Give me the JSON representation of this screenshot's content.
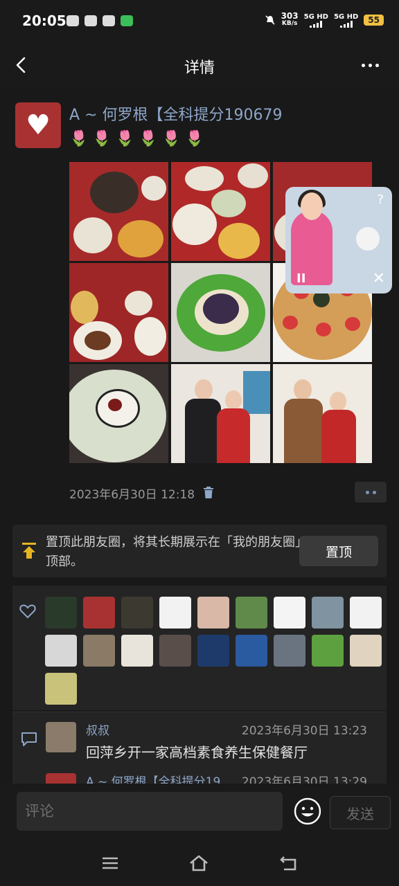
{
  "status_bar": {
    "time": "20:05",
    "speed": "303",
    "speed_unit": "KB/s",
    "net1": "5G HD",
    "net2": "5G HD",
    "battery": "55"
  },
  "nav": {
    "title": "详情",
    "back_icon": "chevron-left-icon",
    "more_icon": "more-dots-icon"
  },
  "post": {
    "author": "A ~ 何罗根【全科提分190679",
    "tulips": "🌷🌷🌷🌷🌷🌷",
    "timestamp": "2023年6月30日 12:18",
    "photos": [
      "banquet-dishes-1",
      "banquet-dishes-2",
      "banquet-dishes-3",
      "banquet-dishes-4",
      "green-plate-dish",
      "strawberry-pizza",
      "calligraphy-plate",
      "chef-and-woman-photo",
      "couple-thumbs-up-photo"
    ]
  },
  "pin_card": {
    "text": "置顶此朋友圈，将其长期展示在「我的朋友圈」顶部。",
    "button": "置顶"
  },
  "comments": [
    {
      "name": "叔叔",
      "time": "2023年6月30日 13:23",
      "text": "回萍乡开一家高档素食养生保健餐厅"
    },
    {
      "name": "A ~ 何罗根【全科提分19…",
      "time": "2023年6月30日 13:29",
      "text": ""
    }
  ],
  "input": {
    "placeholder": "评论",
    "send": "发送"
  },
  "colors": {
    "background": "#191919",
    "card": "#242424",
    "link_blue": "#8ea6c8",
    "muted": "#9a9a9a",
    "pin_yellow": "#e6b422"
  }
}
